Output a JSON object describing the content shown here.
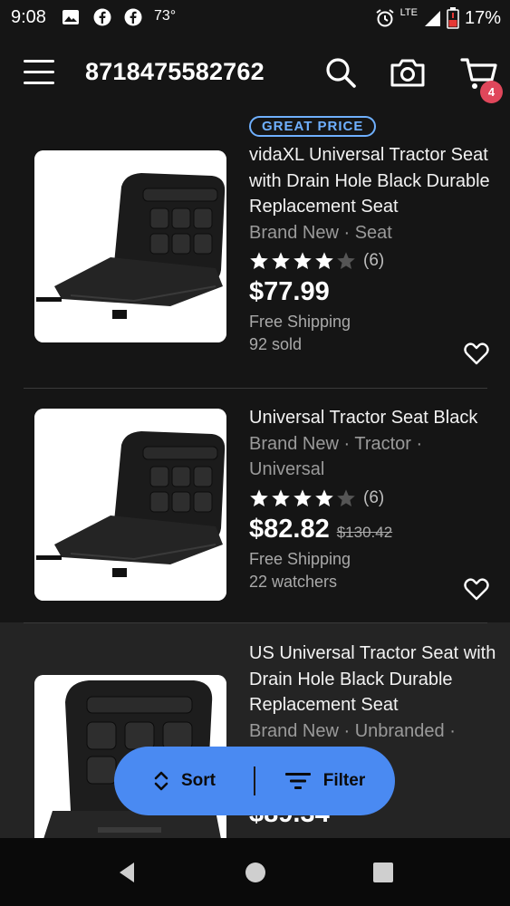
{
  "status_bar": {
    "time": "9:08",
    "temperature": "73°",
    "network": "LTE",
    "battery": "17%",
    "icons": [
      "image-icon",
      "facebook-icon",
      "facebook-icon",
      "alarm-icon",
      "signal-icon",
      "battery-low-icon"
    ]
  },
  "header": {
    "search_query": "8718475582762",
    "cart_count": "4",
    "icons": [
      "menu-icon",
      "search-icon",
      "camera-icon",
      "cart-icon"
    ]
  },
  "listings": [
    {
      "badge": "GREAT PRICE",
      "title": "vidaXL Universal Tractor Seat with Drain Hole Black Durable Replacement Seat",
      "subtitle": "Brand New · Seat",
      "rating_count": "(6)",
      "stars": 4,
      "price": "$77.99",
      "original_price": "",
      "shipping": "Free Shipping",
      "activity": "92 sold"
    },
    {
      "badge": "",
      "title": "Universal Tractor Seat Black",
      "subtitle": "Brand New · Tractor · Universal",
      "rating_count": "(6)",
      "stars": 4,
      "price": "$82.82",
      "original_price": "$130.42",
      "shipping": "Free Shipping",
      "activity": "22 watchers"
    },
    {
      "badge": "",
      "title": "US Universal Tractor Seat with Drain Hole Black Durable Replacement Seat",
      "subtitle": "Brand New · Unbranded · Universal",
      "price": "$89.34"
    }
  ],
  "actions": {
    "sort_label": "Sort",
    "filter_label": "Filter"
  },
  "colors": {
    "background": "#151515",
    "accent_blue": "#4a8af2",
    "badge_blue": "#6fb0ff",
    "cart_badge": "#e0475b"
  }
}
